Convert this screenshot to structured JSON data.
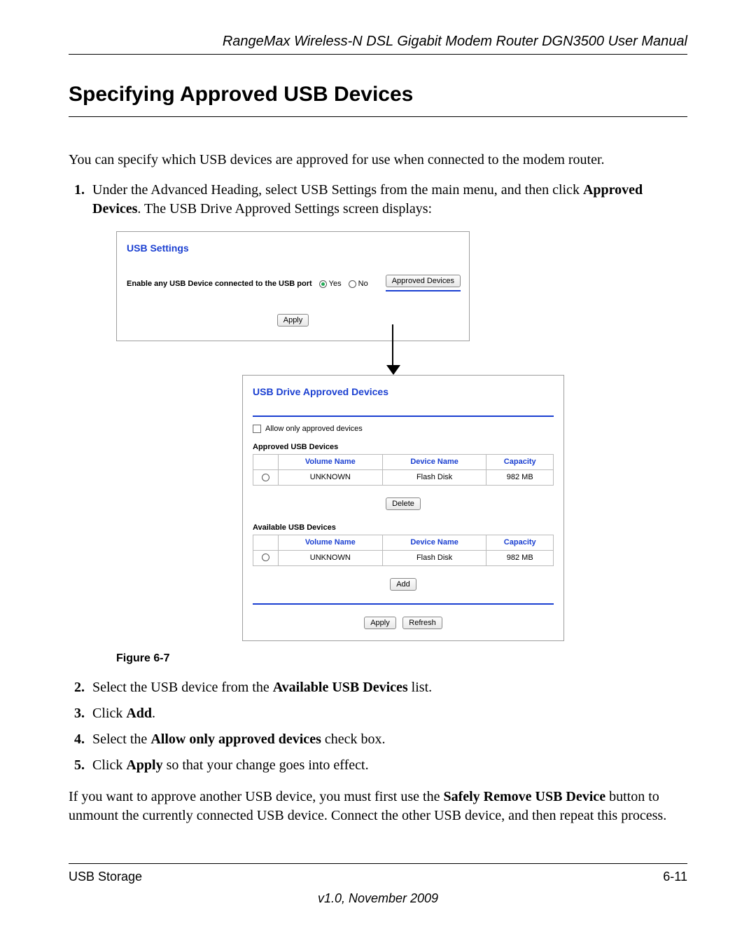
{
  "header": {
    "running": "RangeMax Wireless-N DSL Gigabit Modem Router DGN3500 User Manual"
  },
  "section": {
    "title": "Specifying Approved USB Devices",
    "intro": "You can specify which USB devices are approved for use when connected to the modem router."
  },
  "steps": {
    "s1_a": "Under the Advanced Heading, select USB Settings from the main menu, and then click ",
    "s1_b": "Approved Devices",
    "s1_c": ". The USB Drive Approved Settings screen displays:",
    "s2_a": "Select the USB device from the ",
    "s2_b": "Available USB Devices",
    "s2_c": " list.",
    "s3_a": "Click ",
    "s3_b": "Add",
    "s3_c": ".",
    "s4_a": "Select the ",
    "s4_b": "Allow only approved devices",
    "s4_c": " check box.",
    "s5_a": "Click ",
    "s5_b": "Apply",
    "s5_c": " so that your change goes into effect."
  },
  "panel_top": {
    "title": "USB Settings",
    "enable_label": "Enable any USB Device connected to the USB port",
    "yes": "Yes",
    "no": "No",
    "approved_btn": "Approved Devices",
    "apply_btn": "Apply"
  },
  "panel_bottom": {
    "title": "USB Drive Approved Devices",
    "allow_label": "Allow only approved devices",
    "approved_head": "Approved USB Devices",
    "available_head": "Available USB Devices",
    "col_volume": "Volume Name",
    "col_device": "Device Name",
    "col_capacity": "Capacity",
    "row1": {
      "volume": "UNKNOWN",
      "device": "Flash Disk",
      "capacity": "982 MB"
    },
    "row2": {
      "volume": "UNKNOWN",
      "device": "Flash Disk",
      "capacity": "982 MB"
    },
    "delete_btn": "Delete",
    "add_btn": "Add",
    "apply_btn": "Apply",
    "refresh_btn": "Refresh"
  },
  "figure_caption": "Figure 6-7",
  "closing": {
    "a": "If you want to approve another USB device, you must first use the ",
    "b": "Safely Remove USB Device",
    "c": " button to unmount the currently connected USB device. Connect the other USB device, and then repeat this process."
  },
  "footer": {
    "left": "USB Storage",
    "right": "6-11",
    "version": "v1.0, November 2009"
  }
}
